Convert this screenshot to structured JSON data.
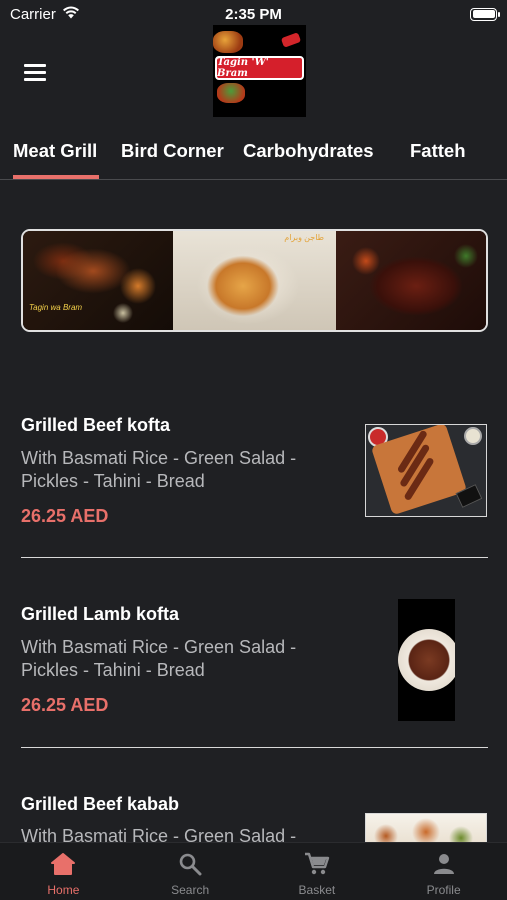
{
  "status_bar": {
    "carrier": "Carrier",
    "time": "2:35 PM"
  },
  "header": {
    "logo_text": "Tagin 'W' Bram"
  },
  "tabs": [
    {
      "label": "Meat Grill",
      "active": true
    },
    {
      "label": "Bird Corner",
      "active": false
    },
    {
      "label": "Carbohydrates",
      "active": false
    },
    {
      "label": "Fatteh",
      "active": false
    }
  ],
  "banner": {
    "watermark_left": "Tagin wa Bram",
    "watermark_middle": "طاجن وبرام"
  },
  "items": [
    {
      "name": "Grilled Beef kofta",
      "description": "With Basmati Rice - Green Salad - Pickles - Tahini - Bread",
      "price": "26.25 AED"
    },
    {
      "name": "Grilled Lamb kofta",
      "description": "With Basmati Rice - Green Salad - Pickles - Tahini - Bread",
      "price": "26.25 AED"
    },
    {
      "name": "Grilled Beef kabab",
      "description": "With Basmati Rice - Green Salad -",
      "price": ""
    }
  ],
  "bottom_nav": [
    {
      "label": "Home",
      "icon": "home-icon",
      "active": true
    },
    {
      "label": "Search",
      "icon": "search-icon",
      "active": false
    },
    {
      "label": "Basket",
      "icon": "cart-icon",
      "active": false
    },
    {
      "label": "Profile",
      "icon": "person-icon",
      "active": false
    }
  ],
  "colors": {
    "background": "#1f2023",
    "accent": "#e8706a",
    "muted_text": "#b7b8bb",
    "nav_inactive": "#8a8b8e"
  }
}
